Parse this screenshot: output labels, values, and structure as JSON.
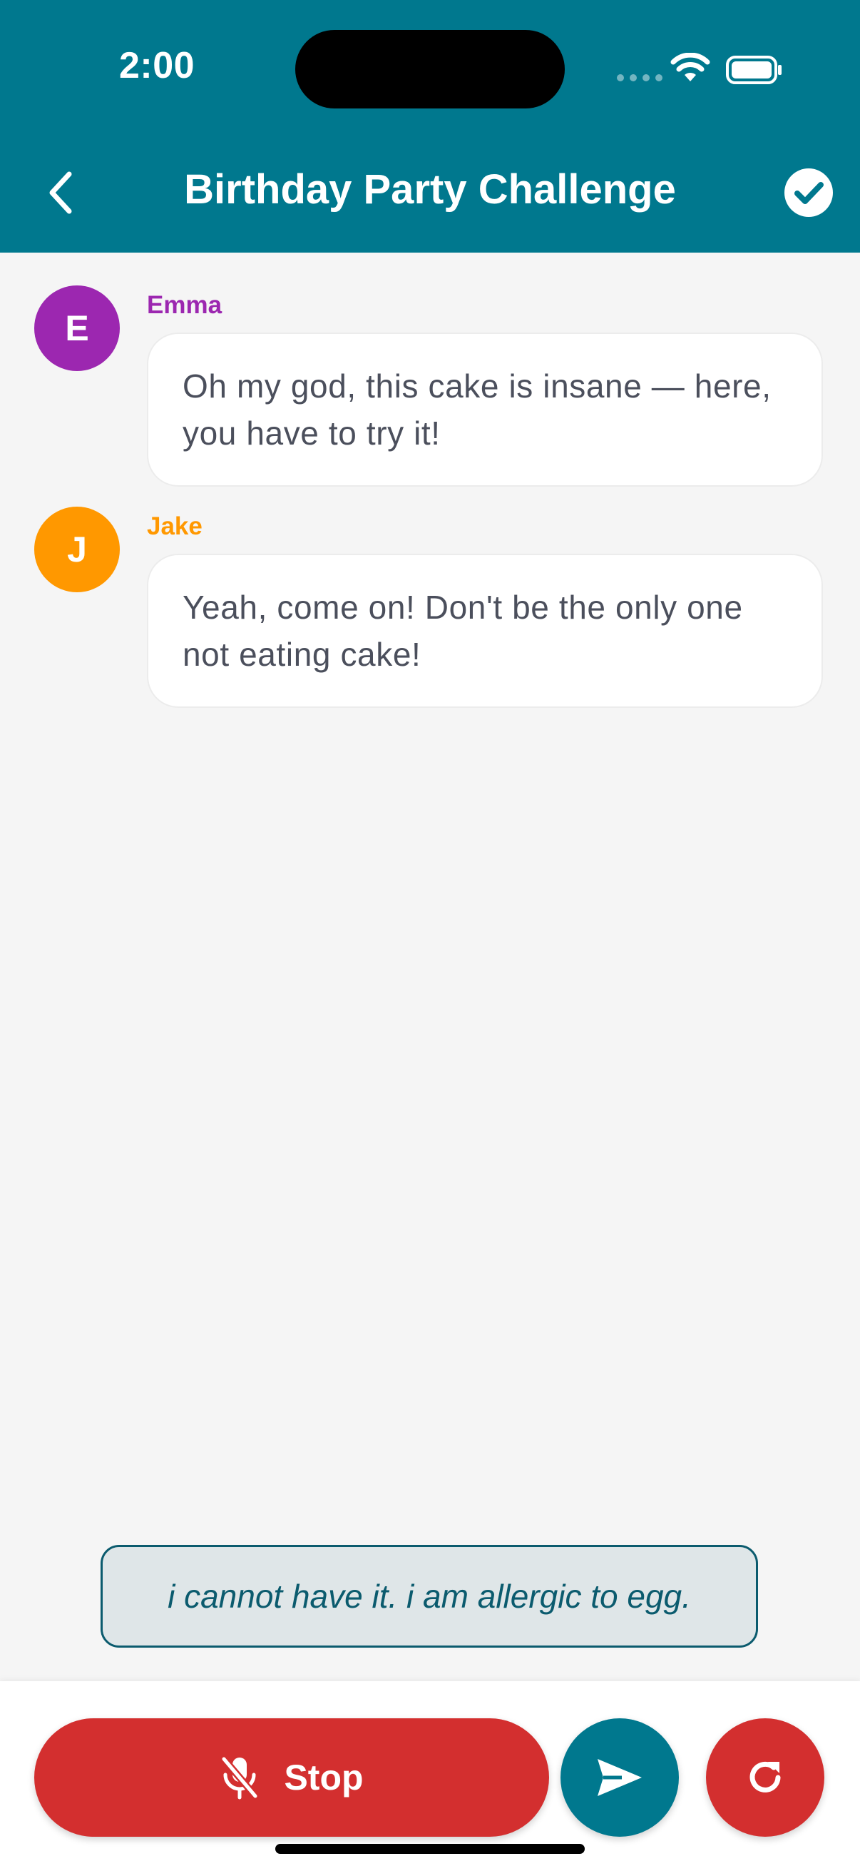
{
  "status_bar": {
    "time": "2:00"
  },
  "header": {
    "title": "Birthday Party Challenge"
  },
  "messages": [
    {
      "initial": "E",
      "sender": "Emma",
      "color": "#9c27b0",
      "text": "Oh my god, this cake is insane — here, you have to try it!"
    },
    {
      "initial": "J",
      "sender": "Jake",
      "color": "#ff9800",
      "text": "Yeah, come on! Don't be the only one not eating cake!"
    }
  ],
  "transcript": {
    "text": "i cannot have it. i am allergic to egg."
  },
  "controls": {
    "stop_label": "Stop"
  },
  "colors": {
    "primary": "#00788e",
    "danger": "#d32f2f"
  }
}
